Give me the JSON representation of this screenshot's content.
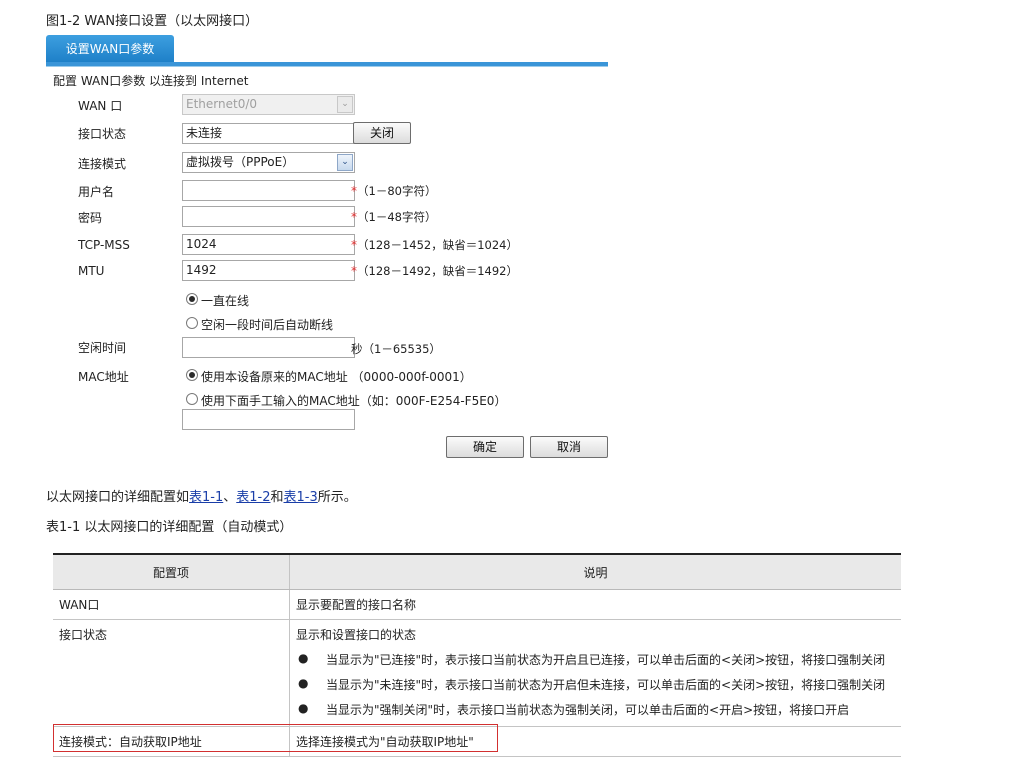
{
  "figure_title": "图1-2 WAN接口设置（以太网接口）",
  "tab_label": "设置WAN口参数",
  "form_subtitle": "配置 WAN口参数 以连接到 Internet",
  "fields": {
    "wan_label": "WAN 口",
    "wan_value": "Ethernet0/0",
    "status_label": "接口状态",
    "status_value": "未连接",
    "status_button": "关闭",
    "mode_label": "连接模式",
    "mode_value": "虚拟拨号（PPPoE）",
    "username_label": "用户名",
    "username_value": "",
    "username_hint": "（1－80字符）",
    "password_label": "密码",
    "password_value": "",
    "password_hint": "（1－48字符）",
    "tcpmss_label": "TCP-MSS",
    "tcpmss_value": "1024",
    "tcpmss_hint": "（128－1452，缺省＝1024）",
    "mtu_label": "MTU",
    "mtu_value": "1492",
    "mtu_hint": "（128－1492，缺省＝1492）",
    "online_always": "一直在线",
    "online_idle": "空闲一段时间后自动断线",
    "idle_label": "空闲时间",
    "idle_value": "",
    "idle_hint": "秒（1－65535）",
    "mac_label": "MAC地址",
    "mac_default": "使用本设备原来的MAC地址 （0000-000f-0001）",
    "mac_manual": "使用下面手工输入的MAC地址（如：000F-E254-F5E0）",
    "mac_manual_value": "",
    "required_mark": "*"
  },
  "buttons": {
    "ok": "确定",
    "cancel": "取消"
  },
  "intro": {
    "prefix": "以太网接口的详细配置如",
    "link1": "表1-1",
    "sep": "、",
    "link2": "表1-2",
    "and": "和",
    "link3": "表1-3",
    "suffix": "所示。"
  },
  "table_caption": "表1-1 以太网接口的详细配置（自动模式）",
  "table": {
    "headers": [
      "配置项",
      "说明"
    ],
    "rows": [
      {
        "item": "WAN口",
        "desc": "显示要配置的接口名称"
      },
      {
        "item": "接口状态",
        "desc": "显示和设置接口的状态",
        "bullets": [
          "当显示为\"已连接\"时，表示接口当前状态为开启且已连接，可以单击后面的<关闭>按钮，将接口强制关闭",
          "当显示为\"未连接\"时，表示接口当前状态为开启但未连接，可以单击后面的<关闭>按钮，将接口强制关闭",
          "当显示为\"强制关闭\"时，表示接口当前状态为强制关闭，可以单击后面的<开启>按钮，将接口开启"
        ]
      },
      {
        "item": "连接模式：自动获取IP地址",
        "desc": "选择连接模式为\"自动获取IP地址\""
      }
    ]
  },
  "bullet_glyph": "●",
  "arrow_glyph": "⌄"
}
